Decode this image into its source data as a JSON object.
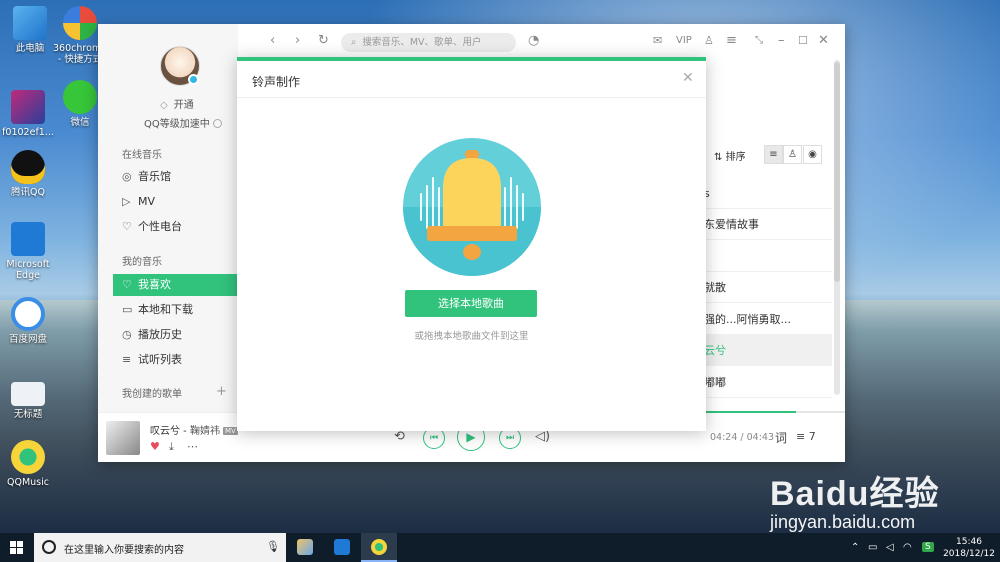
{
  "desktop": {
    "icons": [
      {
        "label": "此电脑"
      },
      {
        "label": "360chrome - 快捷方式"
      },
      {
        "label": "f0102ef1..."
      },
      {
        "label": "微信"
      },
      {
        "label": "腾讯QQ"
      },
      {
        "label": "Microsoft Edge"
      },
      {
        "label": "百度网盘"
      },
      {
        "label": "无标题"
      },
      {
        "label": "QQMusic"
      }
    ],
    "watermark": "Baidu经验",
    "watermark_url": "jingyan.baidu.com"
  },
  "app": {
    "search_placeholder": "搜索音乐、MV、歌单、用户",
    "vip_label": "VIP",
    "user": {
      "open_vip": "开通",
      "level_speed": "QQ等级加速中"
    },
    "sections": {
      "online": "在线音乐",
      "mine": "我的音乐",
      "created": "我创建的歌单"
    },
    "nav_online": [
      {
        "label": "音乐馆",
        "icon": "compass-icon"
      },
      {
        "label": "MV",
        "icon": "video-icon"
      },
      {
        "label": "个性电台",
        "icon": "radio-icon"
      }
    ],
    "nav_mine": [
      {
        "label": "我喜欢",
        "icon": "heart-icon",
        "active": true
      },
      {
        "label": "本地和下载",
        "icon": "monitor-icon"
      },
      {
        "label": "播放历史",
        "icon": "clock-icon"
      },
      {
        "label": "试听列表",
        "icon": "list-icon"
      }
    ],
    "sort_label": "排序",
    "songs_peek": [
      {
        "text": "s"
      },
      {
        "text": "东爱情故事"
      },
      {
        "text": ""
      },
      {
        "text": "就散"
      },
      {
        "text": "强的...阿悄勇取..."
      },
      {
        "text": "云兮",
        "playing": true
      },
      {
        "text": "嘟嘟"
      },
      {
        "text": ""
      }
    ],
    "player": {
      "song": "叹云兮",
      "artist": "鞠婧祎",
      "mv_tag": "MV",
      "time": "04:24 / 04:43",
      "lyric": "词",
      "queue_count": "7",
      "progress": 0.92
    }
  },
  "modal": {
    "title": "铃声制作",
    "button": "选择本地歌曲",
    "hint": "或拖拽本地歌曲文件到这里",
    "accent": "#31c27c"
  },
  "taskbar": {
    "search_placeholder": "在这里输入你要搜索的内容",
    "time": "15:46",
    "date": "2018/12/12"
  }
}
